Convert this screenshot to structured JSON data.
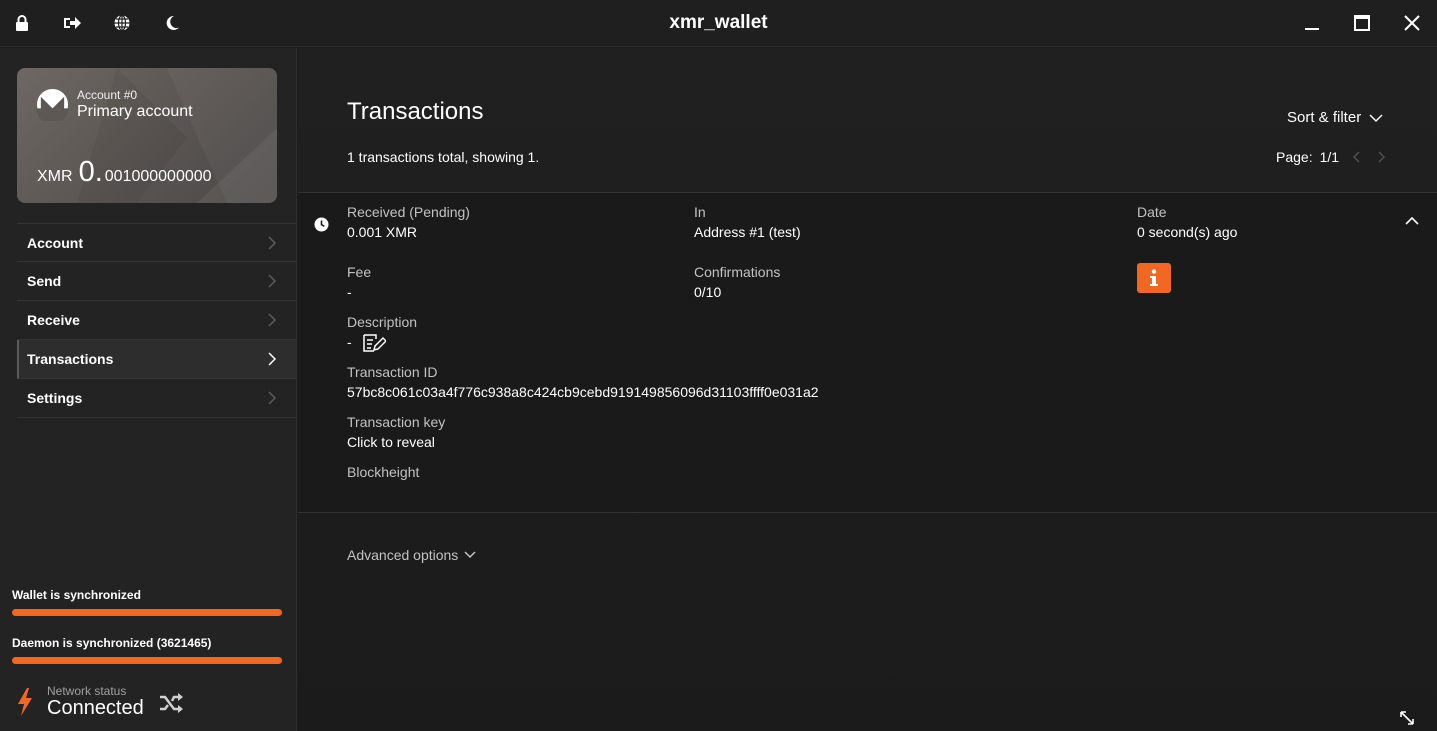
{
  "window": {
    "title": "xmr_wallet",
    "left_icons": [
      "lock-icon",
      "logout-icon",
      "globe-icon",
      "moon-icon"
    ],
    "right_controls": [
      "minimize-icon",
      "maximize-icon",
      "close-icon"
    ]
  },
  "sidebar": {
    "account_card": {
      "account_number": "Account #0",
      "account_name": "Primary account",
      "currency": "XMR",
      "balance_integer": "0.",
      "balance_decimal": "001000000000"
    },
    "nav_items": [
      {
        "label": "Account",
        "active": false
      },
      {
        "label": "Send",
        "active": false
      },
      {
        "label": "Receive",
        "active": false
      },
      {
        "label": "Transactions",
        "active": true
      },
      {
        "label": "Settings",
        "active": false
      }
    ],
    "wallet_sync": {
      "label": "Wallet is synchronized",
      "progress": 1.0
    },
    "daemon_sync": {
      "label": "Daemon is synchronized (3621465)",
      "progress": 1.0
    },
    "network": {
      "label": "Network status",
      "value": "Connected"
    }
  },
  "main": {
    "title": "Transactions",
    "sort_filter_label": "Sort & filter",
    "total_text": "1 transactions total, showing 1.",
    "page_label": "Page:",
    "page_value": "1/1",
    "transaction": {
      "type_label": "Received (Pending)",
      "amount": "0.001 XMR",
      "in_label": "In",
      "in_value": "Address #1 (test)",
      "date_label": "Date",
      "date_value": "0 second(s) ago",
      "fee_label": "Fee",
      "fee_value": "-",
      "confirmations_label": "Confirmations",
      "confirmations_value": "0/10",
      "description_label": "Description",
      "description_value": "-",
      "txid_label": "Transaction ID",
      "txid_value": "57bc8c061c03a4f776c938a8c424cb9cebd919149856096d31103ffff0e031a2",
      "txkey_label": "Transaction key",
      "txkey_value": "Click to reveal",
      "blockheight_label": "Blockheight"
    },
    "advanced_options_label": "Advanced options"
  },
  "colors": {
    "accent": "#f26822",
    "background": "#1d1d1d",
    "sidebar": "#232323",
    "muted_text": "#c2c2c2"
  }
}
